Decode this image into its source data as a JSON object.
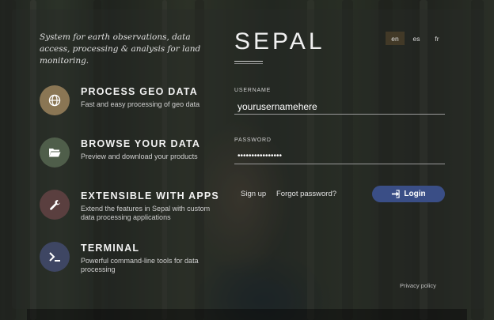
{
  "app": {
    "tagline": "System for earth observations, data access, processing & analysis for land monitoring.",
    "logo": "SEPAL"
  },
  "features": [
    {
      "title": "PROCESS GEO DATA",
      "description": "Fast and easy processing of geo data",
      "icon": "globe-icon",
      "color": "#8a7654"
    },
    {
      "title": "BROWSE YOUR DATA",
      "description": "Preview and download your products",
      "icon": "folder-open-icon",
      "color": "#4f5e4a"
    },
    {
      "title": "EXTENSIBLE WITH APPS",
      "description": "Extend the features in Sepal with custom data processing applications",
      "icon": "wrench-icon",
      "color": "#5a3f3f"
    },
    {
      "title": "TERMINAL",
      "description": "Powerful command-line tools for data processing",
      "icon": "terminal-icon",
      "color": "#3e4663"
    }
  ],
  "languages": [
    "en",
    "es",
    "fr"
  ],
  "active_language": "en",
  "form": {
    "username_label": "USERNAME",
    "username_value": "yourusernamehere",
    "password_label": "PASSWORD",
    "password_value": "••••••••••••••••",
    "sign_up": "Sign up",
    "forgot_password": "Forgot password?",
    "login": "Login"
  },
  "footer": {
    "privacy": "Privacy policy"
  },
  "colors": {
    "accent": "#3a4e86"
  }
}
